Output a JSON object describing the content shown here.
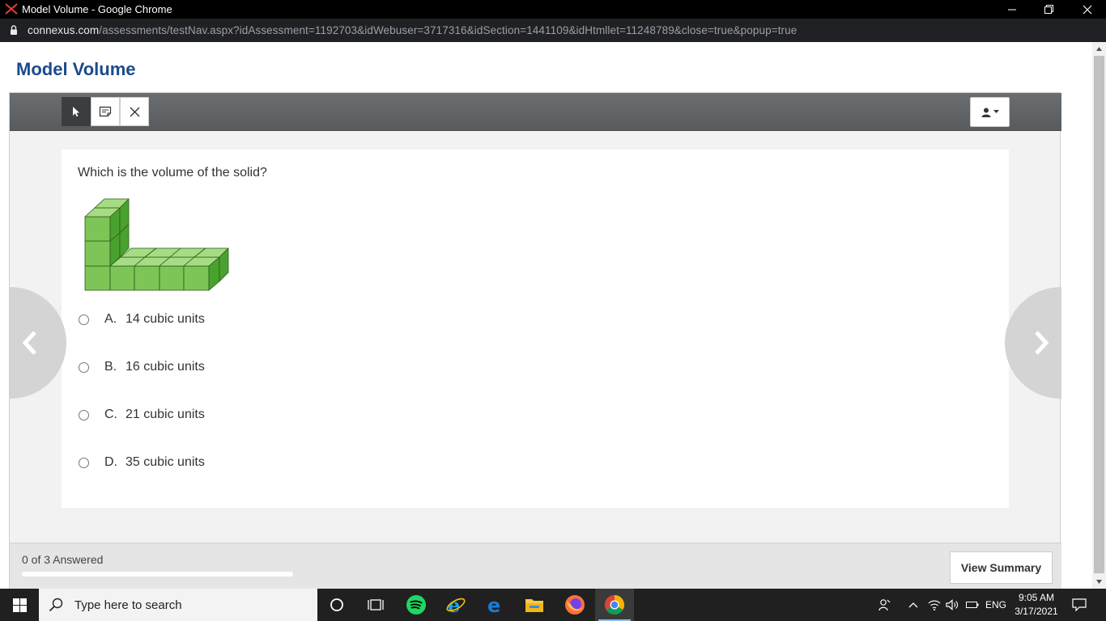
{
  "window": {
    "title": "Model Volume - Google Chrome",
    "url_host": "connexus.com",
    "url_path": "/assessments/testNav.aspx?idAssessment=1192703&idWebuser=3717316&idSection=1441109&idHtmllet=11248789&close=true&popup=true"
  },
  "page": {
    "title": "Model Volume"
  },
  "toolbar": {
    "tools": [
      "pointer-icon",
      "notepad-icon",
      "eliminator-icon"
    ],
    "user_menu_icon": "user-icon"
  },
  "question": {
    "prompt": "Which is the volume of the solid?",
    "figure": "cube-solid-figure",
    "figure_color": "#6cc04a",
    "options": [
      {
        "letter": "A.",
        "text": "14 cubic units"
      },
      {
        "letter": "B.",
        "text": "16 cubic units"
      },
      {
        "letter": "C.",
        "text": "21 cubic units"
      },
      {
        "letter": "D.",
        "text": "35 cubic units"
      }
    ]
  },
  "footer": {
    "answered": "0 of 3 Answered",
    "progress": 0,
    "summary_label": "View Summary"
  },
  "taskbar": {
    "search_placeholder": "Type here to search",
    "apps": [
      "cortana-icon",
      "task-view-icon",
      "spotify-icon",
      "internet-explorer-icon",
      "edge-icon",
      "file-explorer-icon",
      "firefox-icon",
      "chrome-icon"
    ],
    "language": "ENG",
    "time": "9:05 AM",
    "date": "3/17/2021"
  }
}
